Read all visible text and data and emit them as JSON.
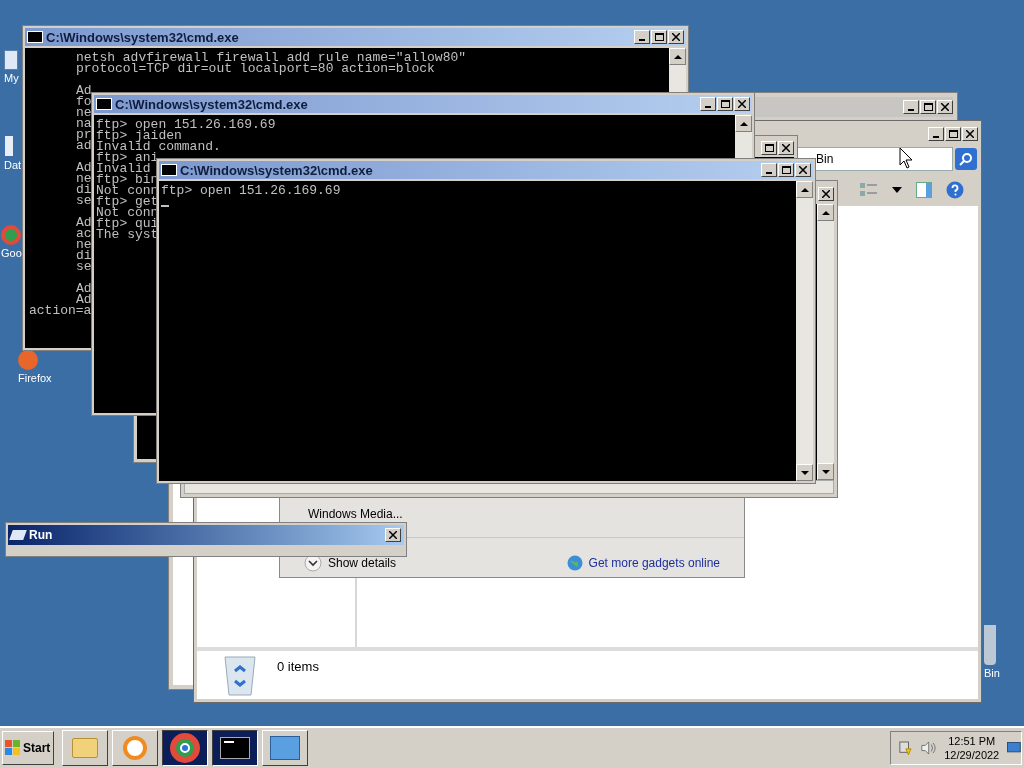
{
  "desktop_icons": [
    {
      "kind": "computer",
      "label": "My"
    },
    {
      "kind": "document",
      "label": "Dat"
    },
    {
      "kind": "chrome",
      "label": "Goo"
    },
    {
      "kind": "firefox",
      "label": "Firefox"
    },
    {
      "kind": "recycle",
      "label": "Bin"
    }
  ],
  "explorer": {
    "search_value": "Bin",
    "status": "0 items"
  },
  "gadgets": {
    "items": [
      {
        "label": "Windows Media..."
      }
    ],
    "show_details": "Show details",
    "online_link": "Get more gadgets online"
  },
  "consoles": [
    {
      "title": "C:\\Windows\\system32\\cmd.exe",
      "cursor": false,
      "blocks": [
        [
          {
            "text": "netsh advfirewall firewall add rule name=\"allow80\"",
            "indented": true
          },
          {
            "text": "protocol=TCP dir=out localport=80 action=block",
            "indented": true
          }
        ],
        [
          {
            "text": "Ad",
            "indented": true
          },
          {
            "text": "fo",
            "indented": true
          },
          {
            "text": "ne",
            "indented": true
          },
          {
            "text": "na",
            "indented": true
          },
          {
            "text": "pr",
            "indented": true
          },
          {
            "text": "ad",
            "indented": true
          }
        ],
        [
          {
            "text": "Ad",
            "indented": true
          },
          {
            "text": "ne",
            "indented": true
          },
          {
            "text": "di",
            "indented": true
          },
          {
            "text": "se",
            "indented": true
          }
        ],
        [
          {
            "text": "Ad",
            "indented": true
          },
          {
            "text": "ac",
            "indented": true
          },
          {
            "text": "ne",
            "indented": true
          },
          {
            "text": "di",
            "indented": true
          },
          {
            "text": "se",
            "indented": true
          }
        ],
        [
          {
            "text": "Ad",
            "indented": true
          },
          {
            "text": "Ad",
            "indented": true
          },
          {
            "text": "action=a",
            "indented": false
          }
        ]
      ]
    },
    {
      "title": "C:\\Windows\\system32\\cmd.exe",
      "cursor": false,
      "blocks": [
        [
          {
            "text": "ftp> open 151.26.169.69"
          },
          {
            "text": "ftp> jaiden"
          },
          {
            "text": "Invalid command."
          },
          {
            "text": "ftp> ani"
          },
          {
            "text": "Invalid"
          },
          {
            "text": "ftp> bin"
          },
          {
            "text": "Not conn"
          },
          {
            "text": "ftp> get"
          },
          {
            "text": "Not conn"
          },
          {
            "text": "ftp> qui"
          },
          {
            "text": "The syst"
          }
        ]
      ]
    },
    {
      "title": "C:\\Windows\\system32\\cmd.exe",
      "cursor": true,
      "blocks": [
        [
          {
            "text": "ftp> open 151.26.169.69"
          }
        ]
      ]
    }
  ],
  "run_dialog": {
    "title": "Run"
  },
  "taskbar": {
    "start": "Start",
    "apps": [
      {
        "kind": "explorer",
        "selected": false
      },
      {
        "kind": "media",
        "selected": false
      },
      {
        "kind": "chrome",
        "selected": true
      },
      {
        "kind": "console",
        "selected": true
      },
      {
        "kind": "remote",
        "selected": false
      }
    ],
    "time": "12:51 PM",
    "date": "12/29/2022"
  }
}
